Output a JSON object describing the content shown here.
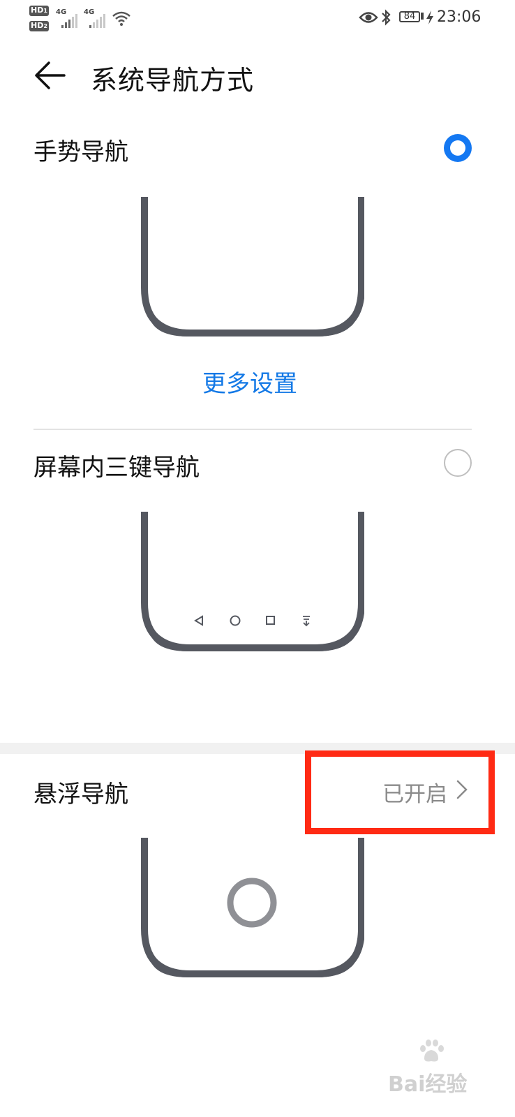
{
  "status_bar": {
    "sim1_badge": "HD",
    "sim1_num": "1",
    "sim2_badge": "HD",
    "sim2_num": "2",
    "net1": "4G",
    "net2": "4G",
    "battery": "84",
    "time": "23:06",
    "icons": [
      "wifi-icon",
      "eye-icon",
      "bluetooth-icon",
      "battery-icon",
      "charging-icon"
    ]
  },
  "header": {
    "back_icon": "back-arrow-icon",
    "title": "系统导航方式"
  },
  "options": [
    {
      "label": "手势导航",
      "selected": true,
      "link": "更多设置"
    },
    {
      "label": "屏幕内三键导航",
      "selected": false,
      "nav_keys": [
        "back-triangle-icon",
        "home-circle-icon",
        "recent-square-icon",
        "notification-down-icon"
      ]
    },
    {
      "label": "悬浮导航",
      "status": "已开启",
      "chevron": "chevron-right-icon"
    }
  ],
  "colors": {
    "accent": "#1478f2",
    "link": "#1479e6",
    "phone_frame": "#555860",
    "highlight": "#ff2a14"
  },
  "watermark": {
    "text": "Bai经验",
    "logo": "baidu-paw-icon"
  }
}
